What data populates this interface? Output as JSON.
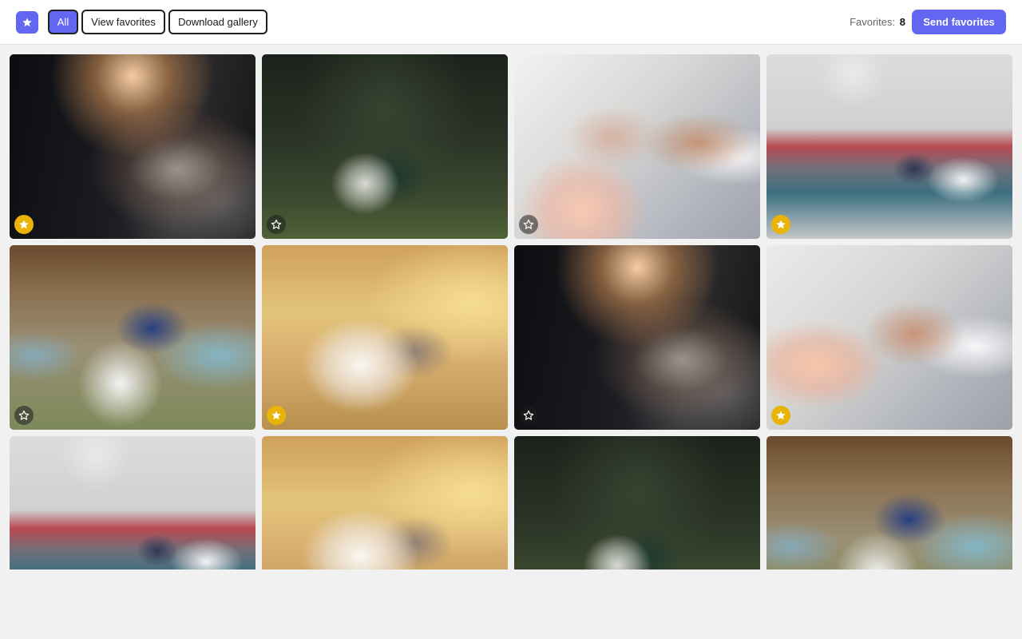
{
  "toolbar": {
    "logo_icon": "star-icon",
    "filters": {
      "all": "All",
      "favorites": "View favorites",
      "download": "Download gallery"
    },
    "active_filter": "all",
    "favorites_label": "Favorites:",
    "favorites_count": "8",
    "send_label": "Send favorites"
  },
  "colors": {
    "accent": "#6366f1",
    "favorite_on": "#eab308",
    "favorite_off": "#1e1e1e"
  },
  "gallery": {
    "photos": [
      {
        "subject": "bouquet-dark",
        "favorited": true
      },
      {
        "subject": "couple-palm",
        "favorited": false
      },
      {
        "subject": "rings-hands",
        "favorited": false
      },
      {
        "subject": "balloons-pool",
        "favorited": true
      },
      {
        "subject": "kiss-petals",
        "favorited": false
      },
      {
        "subject": "couple-lake",
        "favorited": true
      },
      {
        "subject": "bouquet-dark",
        "favorited": false
      },
      {
        "subject": "rings-hands",
        "favorited": true
      },
      {
        "subject": "balloons-pool",
        "favorited": false
      },
      {
        "subject": "couple-lake",
        "favorited": false
      },
      {
        "subject": "couple-palm",
        "favorited": false
      },
      {
        "subject": "kiss-petals",
        "favorited": false
      }
    ]
  }
}
